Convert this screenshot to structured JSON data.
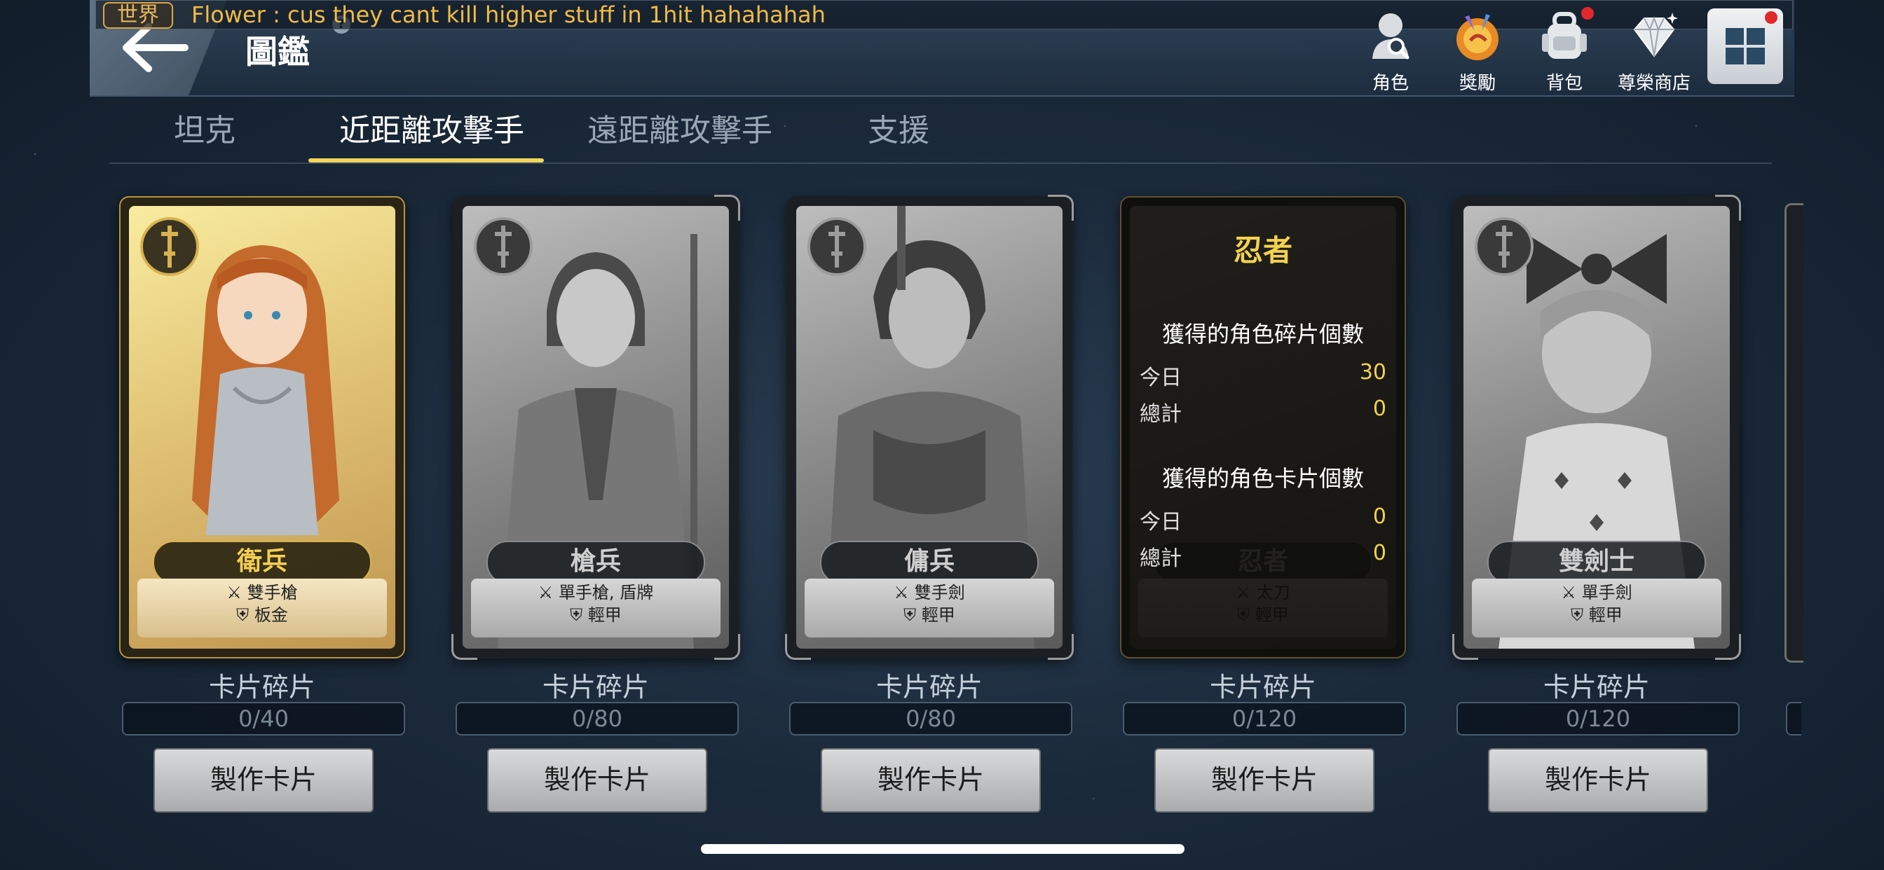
{
  "header": {
    "title": "圖鑑",
    "chat_tag": "世界",
    "chat_message": "Flower : cus they cant kill higher stuff in 1hit hahahahah",
    "help": "?"
  },
  "nav": [
    {
      "label": "角色",
      "icon": "character-search-icon"
    },
    {
      "label": "獎勵",
      "icon": "reward-icon"
    },
    {
      "label": "背包",
      "icon": "backpack-icon"
    },
    {
      "label": "尊榮商店",
      "icon": "diamond-shop-icon"
    }
  ],
  "tabs": [
    {
      "label": "坦克",
      "active": false
    },
    {
      "label": "近距離攻擊手",
      "active": true
    },
    {
      "label": "遠距離攻擊手",
      "active": false
    },
    {
      "label": "支援",
      "active": false
    }
  ],
  "cards": [
    {
      "name": "衛兵",
      "weapon": "雙手槍",
      "armor": "板金",
      "owned": true,
      "fragment_label": "卡片碎片",
      "progress": "0/40",
      "progress_fraction": 0,
      "button": "製作卡片"
    },
    {
      "name": "槍兵",
      "weapon": "單手槍, 盾牌",
      "armor": "輕甲",
      "owned": false,
      "fragment_label": "卡片碎片",
      "progress": "0/80",
      "progress_fraction": 0,
      "button": "製作卡片"
    },
    {
      "name": "傭兵",
      "weapon": "雙手劍",
      "armor": "輕甲",
      "owned": false,
      "fragment_label": "卡片碎片",
      "progress": "0/80",
      "progress_fraction": 0,
      "button": "製作卡片"
    },
    {
      "name": "忍者",
      "weapon": "太刀",
      "armor": "輕甲",
      "owned": false,
      "fragment_label": "卡片碎片",
      "progress": "0/120",
      "progress_fraction": 0,
      "button": "製作卡片",
      "popup": {
        "title": "忍者",
        "shard_heading": "獲得的角色碎片個數",
        "shard_today_label": "今日",
        "shard_today": "30",
        "shard_total_label": "總計",
        "shard_total": "0",
        "card_heading": "獲得的角色卡片個數",
        "card_today_label": "今日",
        "card_today": "0",
        "card_total_label": "總計",
        "card_total": "0"
      }
    },
    {
      "name": "雙劍士",
      "weapon": "單手劍",
      "armor": "輕甲",
      "owned": false,
      "fragment_label": "卡片碎片",
      "progress": "0/120",
      "progress_fraction": 0,
      "button": "製作卡片"
    }
  ],
  "colors": {
    "accent_gold": "#f3d24e",
    "chat_text": "#f1bb48",
    "tab_underline": "#f0d45c",
    "notification": "#e2282d"
  }
}
